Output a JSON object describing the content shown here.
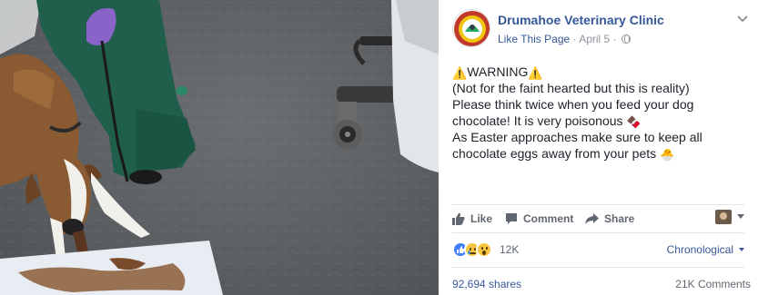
{
  "post": {
    "page_name": "Drumahoe Veterinary Clinic",
    "like_page": "Like This Page",
    "separator": "·",
    "date": "April 5",
    "audience_icon": "globe-icon",
    "options_icon": "chevron-down-icon",
    "lines": [
      {
        "pre": "",
        "emoji_a": "⚠️",
        "text": "WARNING",
        "emoji_b": "⚠️"
      },
      {
        "pre": "",
        "emoji_a": "",
        "text": "(Not for the faint hearted but this is reality)",
        "emoji_b": ""
      },
      {
        "pre": "",
        "emoji_a": "",
        "text": "Please think twice when you feed your dog",
        "emoji_b": ""
      },
      {
        "pre": "",
        "emoji_a": "",
        "text": "chocolate! It is very poisonous ",
        "emoji_b": "🍫"
      },
      {
        "pre": "",
        "emoji_a": "",
        "text": "As Easter approaches make sure to keep all",
        "emoji_b": ""
      },
      {
        "pre": "",
        "emoji_a": "",
        "text": "chocolate eggs away from your pets ",
        "emoji_b": "🐣"
      }
    ]
  },
  "actions": {
    "like": "Like",
    "comment": "Comment",
    "share": "Share"
  },
  "reactions": {
    "types": [
      "like",
      "sad",
      "wow"
    ],
    "count": "12K",
    "sort_label": "Chronological"
  },
  "stats": {
    "shares": "92,694 shares",
    "comments": "21K Comments"
  },
  "colors": {
    "link": "#365899",
    "muted": "#90949c",
    "action": "#606770",
    "like_reaction": "#4080ff",
    "emoji_yellow": "#f7c53f"
  }
}
